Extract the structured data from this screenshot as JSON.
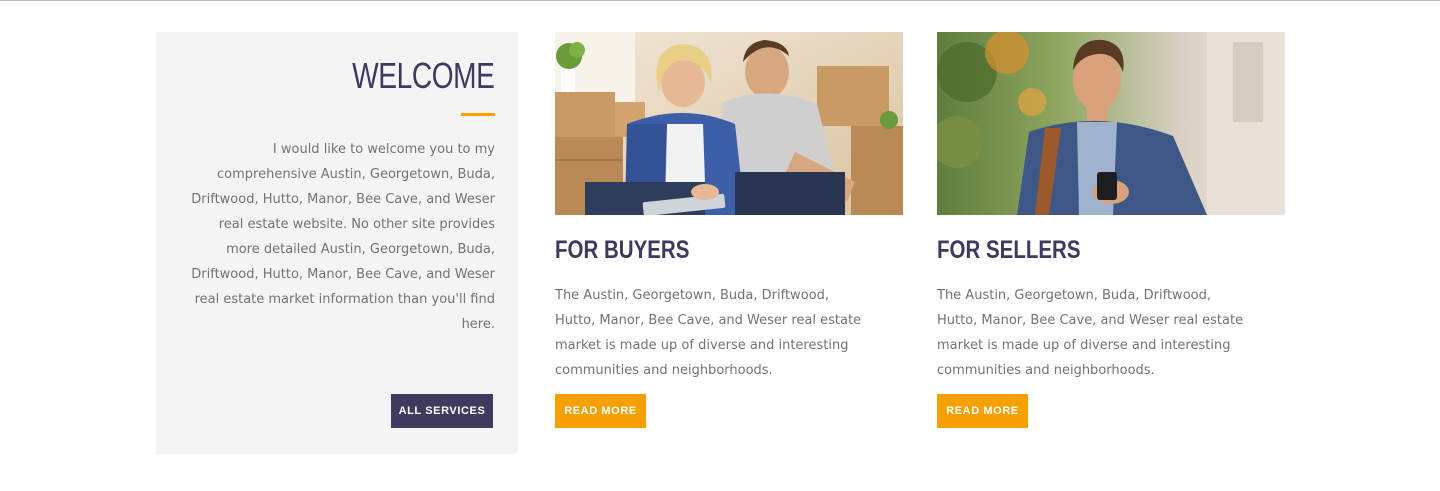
{
  "welcome": {
    "title": "WELCOME",
    "text": "I would like to welcome you to my comprehensive Austin, Georgetown, Buda, Driftwood, Hutto, Manor, Bee Cave, and Weser real estate website. No other site provides more detailed Austin, Georgetown, Buda, Driftwood, Hutto, Manor, Bee Cave, and Weser real estate market information than you'll find here.",
    "button_label": "ALL SERVICES"
  },
  "buyers": {
    "title": "FOR BUYERS",
    "text": "The Austin, Georgetown, Buda, Driftwood, Hutto, Manor, Bee Cave, and Weser real estate market is made up of diverse and interesting communities and neighborhoods.",
    "button_label": "READ MORE"
  },
  "sellers": {
    "title": "FOR SELLERS",
    "text": "The Austin, Georgetown, Buda, Driftwood, Hutto, Manor, Bee Cave, and Weser real estate market is made up of diverse and interesting communities and neighborhoods.",
    "button_label": "READ MORE"
  },
  "colors": {
    "accent": "#f5a300",
    "brand_dark": "#403a5f",
    "card_bg": "#f4f4f4",
    "text": "#737373"
  }
}
